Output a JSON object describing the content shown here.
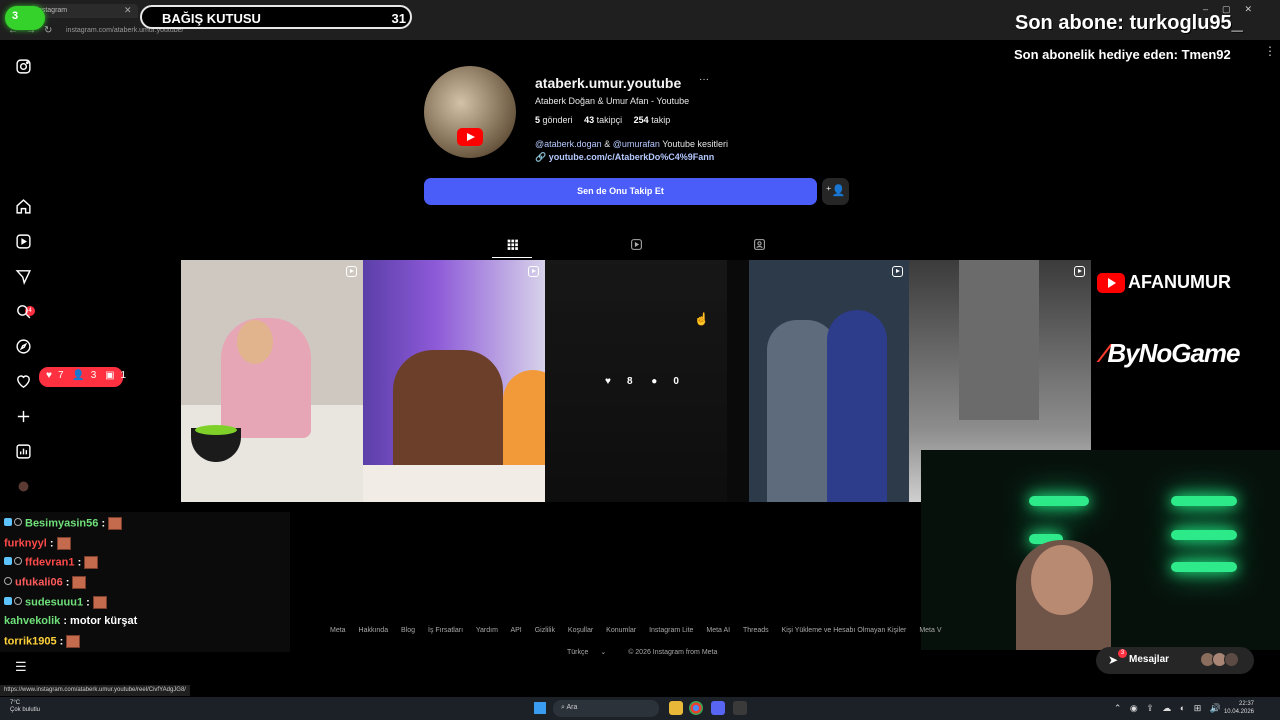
{
  "browser": {
    "tab_title": "Instagram",
    "url": "instagram.com/ataberk.umur.youtube/",
    "status_url": "https://www.instagram.com/ataberk.umur.youtube/reel/CivfYAdgJG8/"
  },
  "overlay": {
    "green_counter": "3",
    "donation_title": "BAĞIŞ KUTUSU",
    "donation_count": "31",
    "last_sub": "Son abone: turkoglu95_",
    "last_gift": "Son abonelik hediye eden: Tmen92",
    "logo_1": "AFANUMUR",
    "logo_2": "ByNoGame"
  },
  "nav": {
    "notif_badge": "4",
    "pill_likes": "7",
    "pill_follows": "3",
    "pill_tags": "1"
  },
  "profile": {
    "username": "ataberk.umur.youtube",
    "fullname": "Ataberk Doğan & Umur Afan - Youtube",
    "posts_count": "5",
    "posts_label": "gönderi",
    "followers_count": "43",
    "followers_label": "takipçi",
    "following_count": "254",
    "following_label": "takip",
    "bio_mention_1": "@ataberk.dogan",
    "bio_amp": "&",
    "bio_mention_2": "@umurafan",
    "bio_rest": "Youtube kesitleri",
    "link": "youtube.com/c/AtaberkDo%C4%9Fann",
    "follow_button": "Sen de Onu Takip Et"
  },
  "posts": {
    "hover_likes": "8",
    "hover_comments": "0"
  },
  "chat": [
    {
      "user": "Besimyasin56",
      "color": "#6fe07a",
      "msg": ""
    },
    {
      "user": "furknyyl",
      "color": "#ff4a4a",
      "msg": ""
    },
    {
      "user": "ffdevran1",
      "color": "#ff4a4a",
      "msg": ""
    },
    {
      "user": "ufukali06",
      "color": "#ff5b5b",
      "msg": ""
    },
    {
      "user": "sudesuuu1",
      "color": "#6fe07a",
      "msg": ""
    },
    {
      "user": "kahvekolik",
      "color": "#6fe07a",
      "msg": "motor kürşat"
    },
    {
      "user": "torrik1905",
      "color": "#ffd23a",
      "msg": ""
    }
  ],
  "footer": {
    "links": [
      "Meta",
      "Hakkında",
      "Blog",
      "İş Fırsatları",
      "Yardım",
      "API",
      "Gizlilik",
      "Koşullar",
      "Konumlar",
      "Instagram Lite",
      "Meta AI",
      "Threads",
      "Kişi Yükleme ve Hesabı Olmayan Kişiler",
      "Meta V"
    ],
    "language": "Türkçe",
    "copyright": "© 2026 Instagram from Meta"
  },
  "messages": {
    "label": "Mesajlar",
    "badge": "3"
  },
  "taskbar": {
    "weather_temp": "7°C",
    "weather_desc": "Çok bulutlu",
    "search_placeholder": "Ara",
    "time": "22:37",
    "date": "10.04.2026"
  }
}
